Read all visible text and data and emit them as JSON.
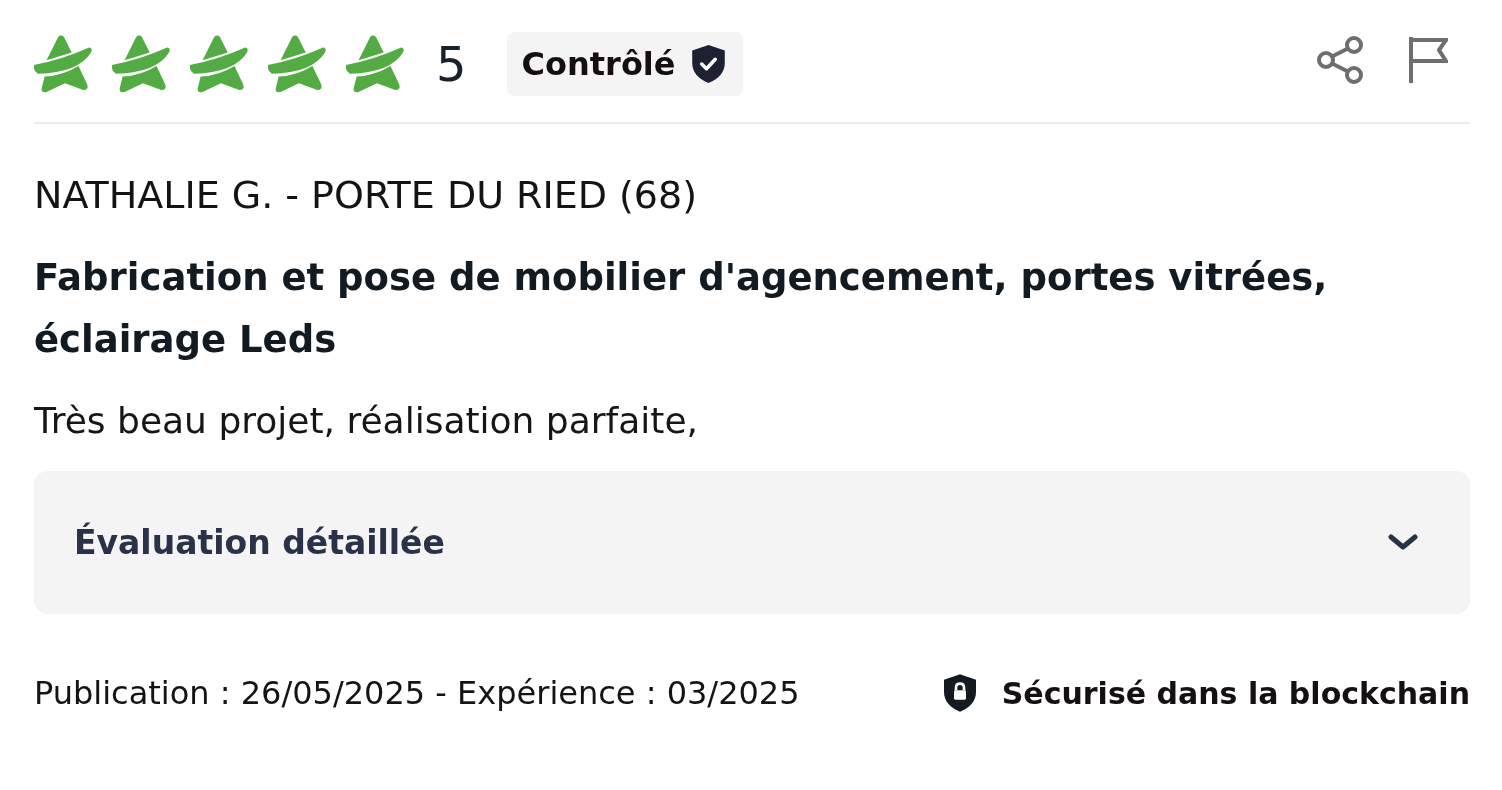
{
  "review": {
    "rating": {
      "stars": 5,
      "score": "5"
    },
    "badge": {
      "label": "Contrôlé"
    },
    "author": "NATHALIE G. - PORTE DU RIED (68)",
    "title": "Fabrication et pose de mobilier d'agencement, portes vitrées, éclairage Leds",
    "comment": "Très beau projet, réalisation parfaite,",
    "details": {
      "label": "Évaluation détaillée",
      "expanded": false
    },
    "footer": {
      "dates": "Publication : 26/05/2025 - Expérience : 03/2025",
      "security": "Sécurisé dans la blockchain"
    }
  }
}
